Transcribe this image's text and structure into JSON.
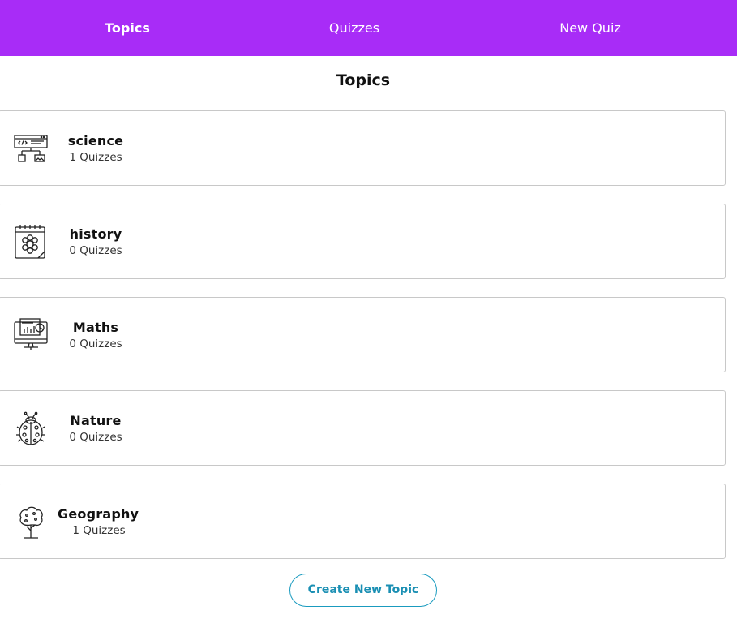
{
  "nav": {
    "items": [
      {
        "label": "Topics",
        "active": true
      },
      {
        "label": "Quizzes",
        "active": false
      },
      {
        "label": "New Quiz",
        "active": false
      }
    ]
  },
  "page": {
    "title": "Topics"
  },
  "topics": [
    {
      "name": "science",
      "count": "1 Quizzes",
      "icon": "code-diagram-icon"
    },
    {
      "name": "history",
      "count": "0 Quizzes",
      "icon": "calendar-flower-icon"
    },
    {
      "name": "Maths",
      "count": "0 Quizzes",
      "icon": "monitor-chart-icon"
    },
    {
      "name": "Nature",
      "count": "0 Quizzes",
      "icon": "ladybug-icon"
    },
    {
      "name": "Geography",
      "count": "1 Quizzes",
      "icon": "tree-icon"
    }
  ],
  "actions": {
    "create_topic_label": "Create New Topic"
  },
  "colors": {
    "navbar": "#a82cf7",
    "button_border": "#1a9bbf",
    "card_border": "#c8c8c8"
  }
}
